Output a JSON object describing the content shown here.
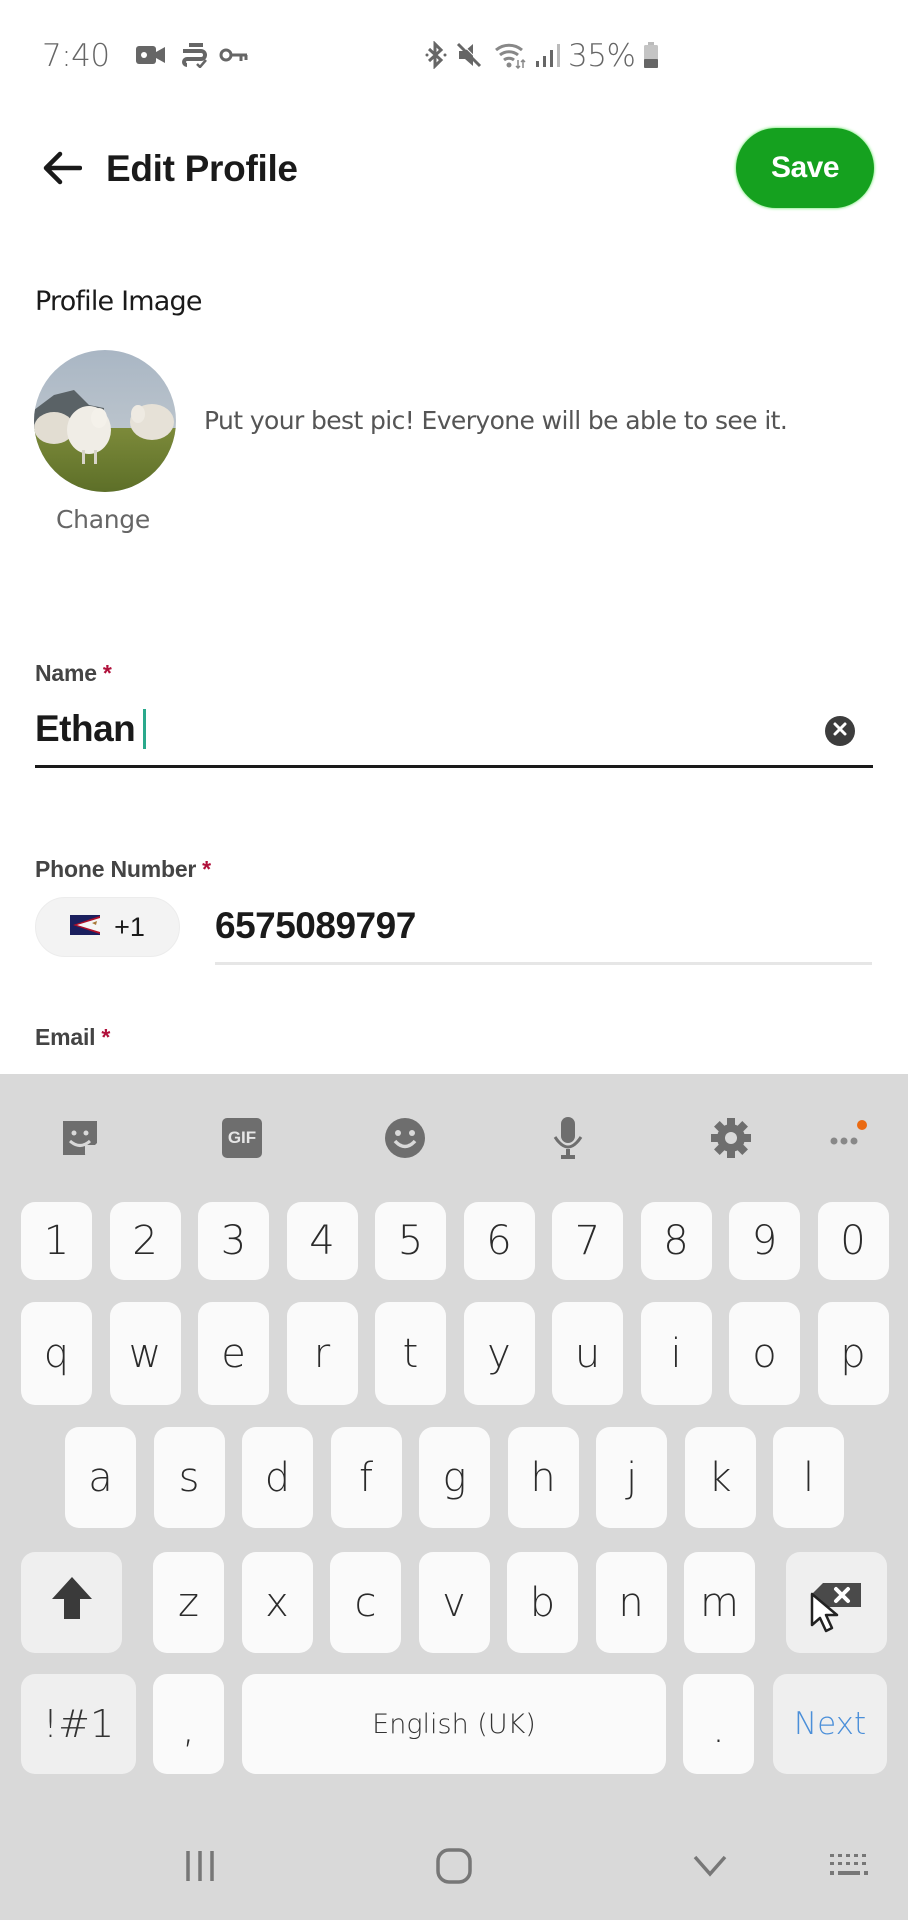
{
  "status_bar": {
    "time": "7:40",
    "left_icons": [
      "video-recording-icon",
      "sync-check-icon",
      "vpn-key-icon"
    ],
    "right_icons": [
      "bluetooth-icon",
      "mute-icon",
      "wifi-icon",
      "signal-icon",
      "battery-icon"
    ],
    "battery_percent": "35%"
  },
  "header": {
    "back_icon": "arrow-left-icon",
    "title": "Edit Profile",
    "save_label": "Save",
    "save_color": "#15a11f"
  },
  "profile_image": {
    "section_label": "Profile Image",
    "helper_text": "Put your best pic! Everyone will be able to see it.",
    "change_label": "Change",
    "image_description": "sheep-on-grassy-hillside"
  },
  "form": {
    "name": {
      "label": "Name",
      "required_mark": "*",
      "value": "Ethan ",
      "clear_icon": "clear-circle-icon"
    },
    "phone": {
      "label": "Phone Number",
      "required_mark": "*",
      "country_flag": "american-samoa-flag-icon",
      "country_code": "+1",
      "value": "6575089797"
    },
    "email": {
      "label": "Email",
      "required_mark": "*"
    }
  },
  "keyboard": {
    "toolbar": [
      {
        "name": "sticker-icon",
        "label": ""
      },
      {
        "name": "gif-icon",
        "label": "GIF"
      },
      {
        "name": "emoji-icon",
        "label": ""
      },
      {
        "name": "microphone-icon",
        "label": ""
      },
      {
        "name": "settings-gear-icon",
        "label": ""
      },
      {
        "name": "more-options-icon",
        "label": ""
      }
    ],
    "row_numbers": [
      "1",
      "2",
      "3",
      "4",
      "5",
      "6",
      "7",
      "8",
      "9",
      "0"
    ],
    "row_top": [
      "q",
      "w",
      "e",
      "r",
      "t",
      "y",
      "u",
      "i",
      "o",
      "p"
    ],
    "row_middle": [
      "a",
      "s",
      "d",
      "f",
      "g",
      "h",
      "j",
      "k",
      "l"
    ],
    "row_bottom": [
      "z",
      "x",
      "c",
      "v",
      "b",
      "n",
      "m"
    ],
    "shift_icon": "shift-arrow-icon",
    "backspace_icon": "backspace-icon",
    "symbols_label": "!#1",
    "comma_label": ",",
    "space_label": "English (UK)",
    "period_label": ".",
    "action_label": "Next",
    "action_color": "#4b8fd9"
  },
  "nav_bar": {
    "items": [
      "recent-apps-icon",
      "home-icon",
      "hide-keyboard-icon",
      "keyboard-switch-icon"
    ]
  }
}
